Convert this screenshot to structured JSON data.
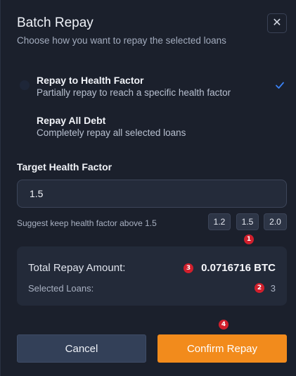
{
  "dialog": {
    "title": "Batch Repay",
    "subtitle": "Choose how you want to repay the selected loans",
    "close_label": "✕"
  },
  "options": [
    {
      "title": "Repay to Health Factor",
      "description": "Partially repay to reach a specific health factor",
      "selected": true
    },
    {
      "title": "Repay All Debt",
      "description": "Completely repay all selected loans",
      "selected": false
    }
  ],
  "target": {
    "label": "Target Health Factor",
    "value": "1.5",
    "hint": "Suggest keep health factor above 1.5",
    "presets": [
      "1.2",
      "1.5",
      "2.0"
    ]
  },
  "summary": {
    "total_label": "Total Repay Amount:",
    "total_value": "0.0716716 BTC",
    "loans_label": "Selected Loans:",
    "loans_value": "3"
  },
  "badges": [
    "1",
    "2",
    "3",
    "4"
  ],
  "buttons": {
    "cancel": "Cancel",
    "confirm": "Confirm Repay"
  },
  "colors": {
    "accent_check": "#3b82f6",
    "confirm_bg": "#f28b1c",
    "badge_bg": "#d11f2c"
  }
}
